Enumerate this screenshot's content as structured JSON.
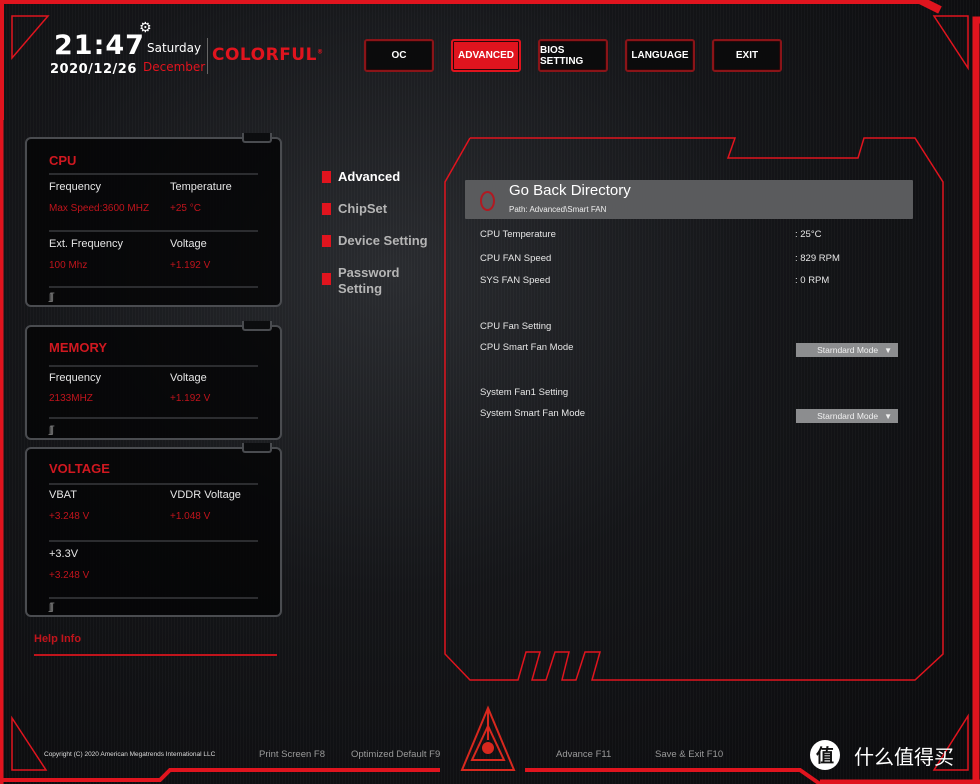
{
  "header": {
    "time": "21:47",
    "date": "2020/12/26",
    "weekday": "Saturday",
    "month": "December",
    "brand": "COLORFUL",
    "brand_mark": "®",
    "settings_icon": "gear-icon"
  },
  "topnav": [
    {
      "label": "OC",
      "active": false
    },
    {
      "label": "ADVANCED",
      "active": true
    },
    {
      "label": "BIOS SETTING",
      "active": false
    },
    {
      "label": "LANGUAGE",
      "active": false
    },
    {
      "label": "EXIT",
      "active": false
    }
  ],
  "cpu": {
    "title": "CPU",
    "frequency_label": "Frequency",
    "frequency_value": "Max Speed:3600 MHZ",
    "temperature_label": "Temperature",
    "temperature_value": "+25 °C",
    "ext_frequency_label": "Ext. Frequency",
    "ext_frequency_value": "100 Mhz",
    "voltage_label": "Voltage",
    "voltage_value": "+1.192 V"
  },
  "memory": {
    "title": "MEMORY",
    "frequency_label": "Frequency",
    "frequency_value": "2133MHZ",
    "voltage_label": "Voltage",
    "voltage_value": "+1.192 V"
  },
  "voltage": {
    "title": "VOLTAGE",
    "vbat_label": "VBAT",
    "vbat_value": "+3.248 V",
    "vddr_label": "VDDR Voltage",
    "vddr_value": "+1.048 V",
    "v33_label": "+3.3V",
    "v33_value": "+3.248 V"
  },
  "help": {
    "title": "Help Info"
  },
  "menu": [
    {
      "label": "Advanced",
      "active": true
    },
    {
      "label": "ChipSet",
      "active": false
    },
    {
      "label": "Device Setting",
      "active": false
    },
    {
      "label": "Password Setting",
      "active": false
    }
  ],
  "panel": {
    "back_title": "Go Back Directory",
    "path": "Path: Advanced\\Smart FAN",
    "readings": [
      {
        "label": "CPU Temperature",
        "value": ":  25°C"
      },
      {
        "label": "CPU FAN Speed",
        "value": ": 829 RPM"
      },
      {
        "label": "SYS FAN Speed",
        "value": ": 0 RPM"
      }
    ],
    "cpu_fan_section": "CPU Fan Setting",
    "cpu_fan_mode_label": "CPU Smart Fan Mode",
    "cpu_fan_mode_value": "Starndard Mode",
    "sys_fan_section": "System Fan1 Setting",
    "sys_fan_mode_label": "System Smart Fan Mode",
    "sys_fan_mode_value": "Starndard Mode"
  },
  "footer": {
    "copyright": "Copyright (C) 2020 American Megatrends International LLC",
    "print_screen": "Print Screen F8",
    "optimized_default": "Optimized Default F9",
    "advance": "Advance F11",
    "save_exit": "Save & Exit F10"
  },
  "watermark": {
    "glyph": "值",
    "text": "什么值得买"
  },
  "colors": {
    "accent": "#e0141e",
    "value_red": "#c0141c",
    "dropdown_bg": "#8c8d8f",
    "back_bar": "#5a5b5d"
  }
}
